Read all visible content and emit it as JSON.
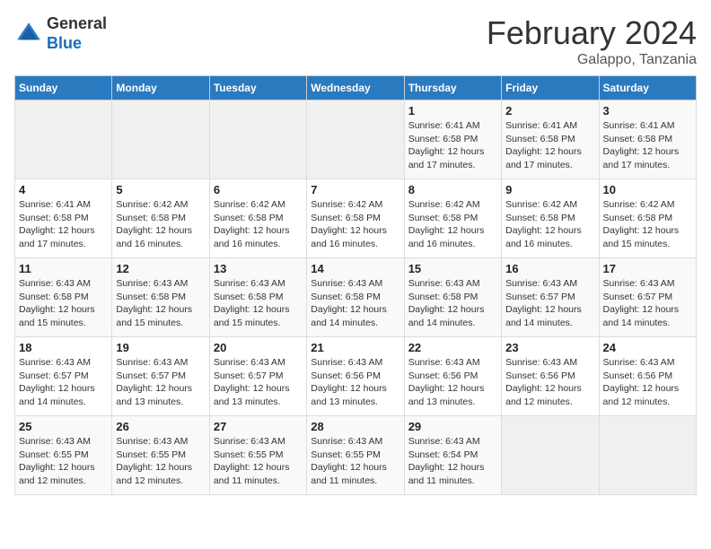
{
  "header": {
    "logo_line1": "General",
    "logo_line2": "Blue",
    "month_title": "February 2024",
    "location": "Galappo, Tanzania"
  },
  "days_of_week": [
    "Sunday",
    "Monday",
    "Tuesday",
    "Wednesday",
    "Thursday",
    "Friday",
    "Saturday"
  ],
  "weeks": [
    [
      {
        "day": "",
        "info": ""
      },
      {
        "day": "",
        "info": ""
      },
      {
        "day": "",
        "info": ""
      },
      {
        "day": "",
        "info": ""
      },
      {
        "day": "1",
        "info": "Sunrise: 6:41 AM\nSunset: 6:58 PM\nDaylight: 12 hours\nand 17 minutes."
      },
      {
        "day": "2",
        "info": "Sunrise: 6:41 AM\nSunset: 6:58 PM\nDaylight: 12 hours\nand 17 minutes."
      },
      {
        "day": "3",
        "info": "Sunrise: 6:41 AM\nSunset: 6:58 PM\nDaylight: 12 hours\nand 17 minutes."
      }
    ],
    [
      {
        "day": "4",
        "info": "Sunrise: 6:41 AM\nSunset: 6:58 PM\nDaylight: 12 hours\nand 17 minutes."
      },
      {
        "day": "5",
        "info": "Sunrise: 6:42 AM\nSunset: 6:58 PM\nDaylight: 12 hours\nand 16 minutes."
      },
      {
        "day": "6",
        "info": "Sunrise: 6:42 AM\nSunset: 6:58 PM\nDaylight: 12 hours\nand 16 minutes."
      },
      {
        "day": "7",
        "info": "Sunrise: 6:42 AM\nSunset: 6:58 PM\nDaylight: 12 hours\nand 16 minutes."
      },
      {
        "day": "8",
        "info": "Sunrise: 6:42 AM\nSunset: 6:58 PM\nDaylight: 12 hours\nand 16 minutes."
      },
      {
        "day": "9",
        "info": "Sunrise: 6:42 AM\nSunset: 6:58 PM\nDaylight: 12 hours\nand 16 minutes."
      },
      {
        "day": "10",
        "info": "Sunrise: 6:42 AM\nSunset: 6:58 PM\nDaylight: 12 hours\nand 15 minutes."
      }
    ],
    [
      {
        "day": "11",
        "info": "Sunrise: 6:43 AM\nSunset: 6:58 PM\nDaylight: 12 hours\nand 15 minutes."
      },
      {
        "day": "12",
        "info": "Sunrise: 6:43 AM\nSunset: 6:58 PM\nDaylight: 12 hours\nand 15 minutes."
      },
      {
        "day": "13",
        "info": "Sunrise: 6:43 AM\nSunset: 6:58 PM\nDaylight: 12 hours\nand 15 minutes."
      },
      {
        "day": "14",
        "info": "Sunrise: 6:43 AM\nSunset: 6:58 PM\nDaylight: 12 hours\nand 14 minutes."
      },
      {
        "day": "15",
        "info": "Sunrise: 6:43 AM\nSunset: 6:58 PM\nDaylight: 12 hours\nand 14 minutes."
      },
      {
        "day": "16",
        "info": "Sunrise: 6:43 AM\nSunset: 6:57 PM\nDaylight: 12 hours\nand 14 minutes."
      },
      {
        "day": "17",
        "info": "Sunrise: 6:43 AM\nSunset: 6:57 PM\nDaylight: 12 hours\nand 14 minutes."
      }
    ],
    [
      {
        "day": "18",
        "info": "Sunrise: 6:43 AM\nSunset: 6:57 PM\nDaylight: 12 hours\nand 14 minutes."
      },
      {
        "day": "19",
        "info": "Sunrise: 6:43 AM\nSunset: 6:57 PM\nDaylight: 12 hours\nand 13 minutes."
      },
      {
        "day": "20",
        "info": "Sunrise: 6:43 AM\nSunset: 6:57 PM\nDaylight: 12 hours\nand 13 minutes."
      },
      {
        "day": "21",
        "info": "Sunrise: 6:43 AM\nSunset: 6:56 PM\nDaylight: 12 hours\nand 13 minutes."
      },
      {
        "day": "22",
        "info": "Sunrise: 6:43 AM\nSunset: 6:56 PM\nDaylight: 12 hours\nand 13 minutes."
      },
      {
        "day": "23",
        "info": "Sunrise: 6:43 AM\nSunset: 6:56 PM\nDaylight: 12 hours\nand 12 minutes."
      },
      {
        "day": "24",
        "info": "Sunrise: 6:43 AM\nSunset: 6:56 PM\nDaylight: 12 hours\nand 12 minutes."
      }
    ],
    [
      {
        "day": "25",
        "info": "Sunrise: 6:43 AM\nSunset: 6:55 PM\nDaylight: 12 hours\nand 12 minutes."
      },
      {
        "day": "26",
        "info": "Sunrise: 6:43 AM\nSunset: 6:55 PM\nDaylight: 12 hours\nand 12 minutes."
      },
      {
        "day": "27",
        "info": "Sunrise: 6:43 AM\nSunset: 6:55 PM\nDaylight: 12 hours\nand 11 minutes."
      },
      {
        "day": "28",
        "info": "Sunrise: 6:43 AM\nSunset: 6:55 PM\nDaylight: 12 hours\nand 11 minutes."
      },
      {
        "day": "29",
        "info": "Sunrise: 6:43 AM\nSunset: 6:54 PM\nDaylight: 12 hours\nand 11 minutes."
      },
      {
        "day": "",
        "info": ""
      },
      {
        "day": "",
        "info": ""
      }
    ]
  ]
}
